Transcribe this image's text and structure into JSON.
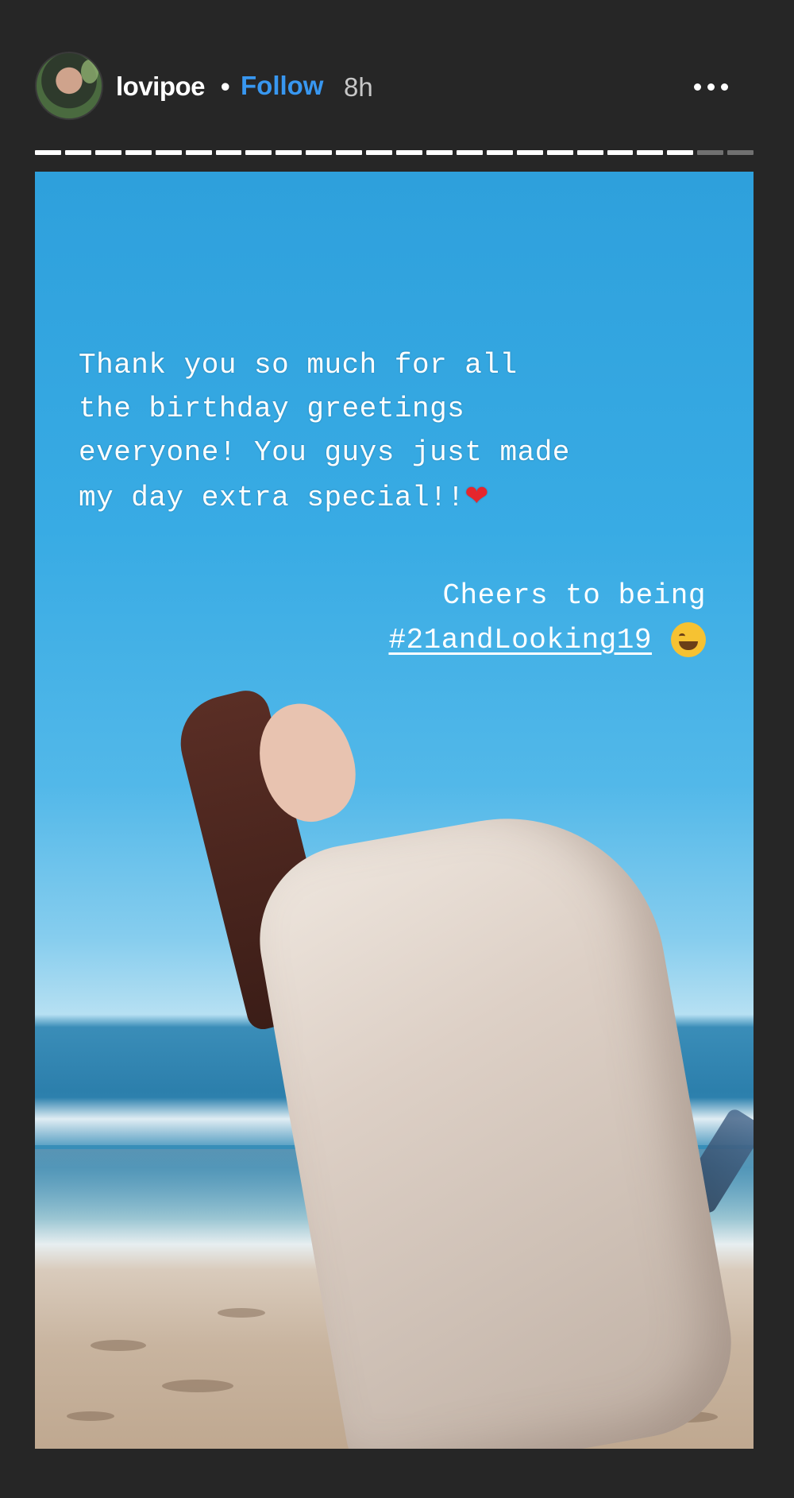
{
  "header": {
    "username": "lovipoe",
    "separator": "•",
    "follow_label": "Follow",
    "time": "8h",
    "more_icon": "more-horizontal-icon"
  },
  "progress": {
    "total_segments": 24,
    "completed_segments": 22
  },
  "story": {
    "caption_lines": [
      "Thank you so much for all",
      "the birthday greetings",
      "everyone! You guys just made",
      "my day extra special!!"
    ],
    "heart_emoji": "❤",
    "cheers_text": "Cheers to being",
    "hashtag": "#21andLooking19",
    "laugh_emoji_icon": "grinning-squinting-face-icon"
  },
  "colors": {
    "background": "#262626",
    "follow": "#3897f0",
    "heart": "#e6262d"
  }
}
